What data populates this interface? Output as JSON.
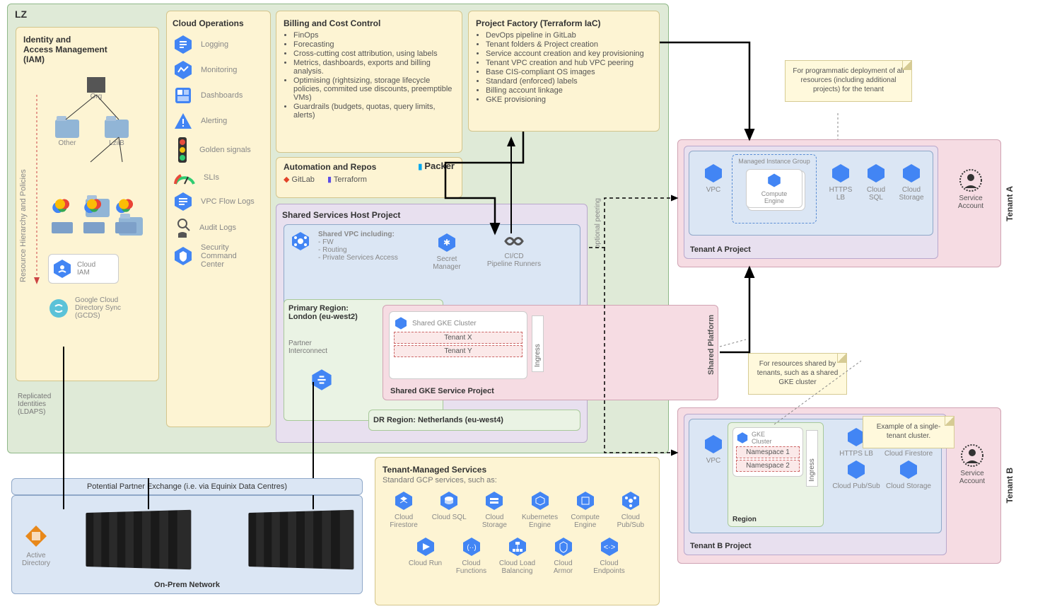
{
  "lz_label": "LZ",
  "iam": {
    "title": "Identity and\nAccess Management\n(IAM)",
    "side_label": "Resource Hierarchy and Policies",
    "org": "Org",
    "folders": [
      "Other",
      "LziiB"
    ],
    "cloud_iam": "Cloud\nIAM",
    "gcds": "Google Cloud\nDirectory Sync\n(GCDS)",
    "replicated": "Replicated\nIdentities\n(LDAPS)"
  },
  "cloud_ops": {
    "title": "Cloud Operations",
    "items": [
      "Logging",
      "Monitoring",
      "Dashboards",
      "Alerting",
      "Golden signals",
      "SLIs",
      "VPC Flow Logs",
      "Audit Logs",
      "Security\nCommand\nCenter"
    ]
  },
  "billing": {
    "title": "Billing and Cost Control",
    "items": [
      "FinOps",
      "Forecasting",
      "Cross-cutting cost attribution, using labels",
      "Metrics, dashboards, exports and billing analysis.",
      "Optimising (rightsizing, storage lifecycle policies, commited use discounts, preemptible VMs)",
      "Guardrails (budgets, quotas, query limits, alerts)"
    ]
  },
  "factory": {
    "title": "Project Factory (Terraform IaC)",
    "items": [
      "DevOps pipeline in GitLab",
      "Tenant folders & Project creation",
      "Service account creation and key provisioning",
      "Tenant VPC creation and hub VPC peering",
      "Base CIS-compliant OS images",
      "Standard (enforced) labels",
      "Billing account linkage",
      "GKE provisioning"
    ]
  },
  "automation": {
    "title": "Automation and Repos",
    "tools": [
      "GitLab",
      "Terraform",
      "Packer"
    ]
  },
  "shared_host": {
    "title": "Shared Services Host Project",
    "vpc_title": "Shared VPC including:",
    "vpc_items": [
      "FW",
      "Routing",
      "Private Services Access"
    ],
    "secret": "Secret\nManager",
    "cicd": "CI/CD\nPipeline Runners",
    "primary_region": "Primary Region:\nLondon (eu-west2)",
    "partner_ic": "Partner\nInterconnect",
    "dr_region": "DR Region: Netherlands (eu-west4)",
    "gke_cluster": "Shared GKE Cluster",
    "gke_tenants": [
      "Tenant X",
      "Tenant Y"
    ],
    "ingress": "Ingress",
    "gke_project": "Shared GKE Service Project"
  },
  "shared_platform": {
    "label": "Shared Platform",
    "optional_peering": "optional peering"
  },
  "tenant_managed": {
    "title": "Tenant-Managed Services",
    "subtitle": "Standard GCP services, such as:",
    "row1": [
      "Cloud\nFirestore",
      "Cloud SQL",
      "Cloud\nStorage",
      "Kubernetes\nEngine",
      "Compute\nEngine",
      "Cloud\nPub/Sub"
    ],
    "row2": [
      "Cloud Run",
      "Cloud\nFunctions",
      "Cloud Load\nBalancing",
      "Cloud\nArmor",
      "Cloud\nEndpoints"
    ]
  },
  "onprem": {
    "exchange": "Potential Partner Exchange (i.e. via Equinix Data Centres)",
    "ad": "Active\nDirectory",
    "label": "On-Prem Network"
  },
  "tenant_a": {
    "label": "Tenant A",
    "proj": "Tenant A Project",
    "vpc": "VPC",
    "mig": "Managed Instance Group",
    "compute": "Compute\nEngine",
    "svcs": [
      "HTTPS\nLB",
      "Cloud\nSQL",
      "Cloud\nStorage"
    ],
    "sa": "Service\nAccount"
  },
  "tenant_b": {
    "label": "Tenant B",
    "proj": "Tenant B Project",
    "vpc": "VPC",
    "gke": "GKE\nCluster",
    "ns": [
      "Namespace 1",
      "Namespace 2"
    ],
    "region": "Region",
    "ingress": "Ingress",
    "svcs": [
      "HTTPS LB",
      "Cloud Firestore",
      "Cloud Pub/Sub",
      "Cloud Storage"
    ],
    "sa": "Service\nAccount"
  },
  "notes": {
    "a": "For programmatic deployment of all resources (including additional projects) for the tenant",
    "shared": "For resources shared by tenants, such as a shared GKE cluster",
    "b": "Example of a single-tenant cluster."
  }
}
